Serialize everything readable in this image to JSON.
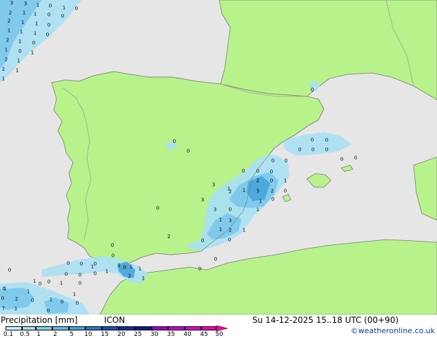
{
  "map": {
    "colors": {
      "sea": "#e6e6e6",
      "land": "#b8f28a",
      "border": "#a0a0a0",
      "coast": "#7a7a7a",
      "precip_light": "#a8e0f4",
      "precip_mid": "#7ac8ec",
      "precip_heavy": "#4aa8dc"
    },
    "values": [
      "3",
      "3",
      "1",
      "0",
      "1",
      "0",
      "2",
      "1",
      "1",
      "0",
      "0",
      "2",
      "1",
      "1",
      "0",
      "1",
      "1",
      "1",
      "0",
      "2",
      "1",
      "0",
      "1",
      "0",
      "1",
      "2",
      "1",
      "2",
      "1",
      "1",
      "0",
      "0",
      "0",
      "0",
      "0",
      "0",
      "0",
      "0",
      "0",
      "0",
      "0",
      "0",
      "0",
      "1",
      "0",
      "0",
      "3",
      "1",
      "3",
      "2",
      "0",
      "1",
      "2",
      "2",
      "0",
      "1",
      "3",
      "0",
      "0",
      "3",
      "1",
      "1",
      "3",
      "1",
      "1",
      "2",
      "0",
      "0",
      "0",
      "0",
      "0",
      "0",
      "0",
      "0",
      "0",
      "0",
      "0",
      "0",
      "1",
      "0",
      "1",
      "1",
      "1",
      "0",
      "0",
      "1",
      "2",
      "0",
      "0",
      "0",
      "1",
      "7",
      "0",
      "2",
      "1",
      "1",
      "2",
      "1",
      "0",
      "0",
      "0",
      "0",
      "1",
      "1",
      "0",
      "1",
      "1",
      "0"
    ]
  },
  "footer": {
    "title": "Precipitation [mm]",
    "model": "ICON",
    "timestamp": "Su 14-12-2025 15..18 UTC (00+90)",
    "credit": "©weatheronline.co.uk"
  },
  "legend": {
    "ticks": [
      "0.1",
      "0.5",
      "1",
      "2",
      "5",
      "10",
      "15",
      "20",
      "25",
      "30",
      "35",
      "40",
      "45",
      "50"
    ],
    "colors": [
      "#c8f0fc",
      "#a8e0f4",
      "#88d0ec",
      "#64bce4",
      "#44a4dc",
      "#2878c8",
      "#1c50b4",
      "#1030a0",
      "#0c1c8c",
      "#a000c8",
      "#c800d0",
      "#dc00c8",
      "#f000b4",
      "#ff00a0"
    ]
  }
}
